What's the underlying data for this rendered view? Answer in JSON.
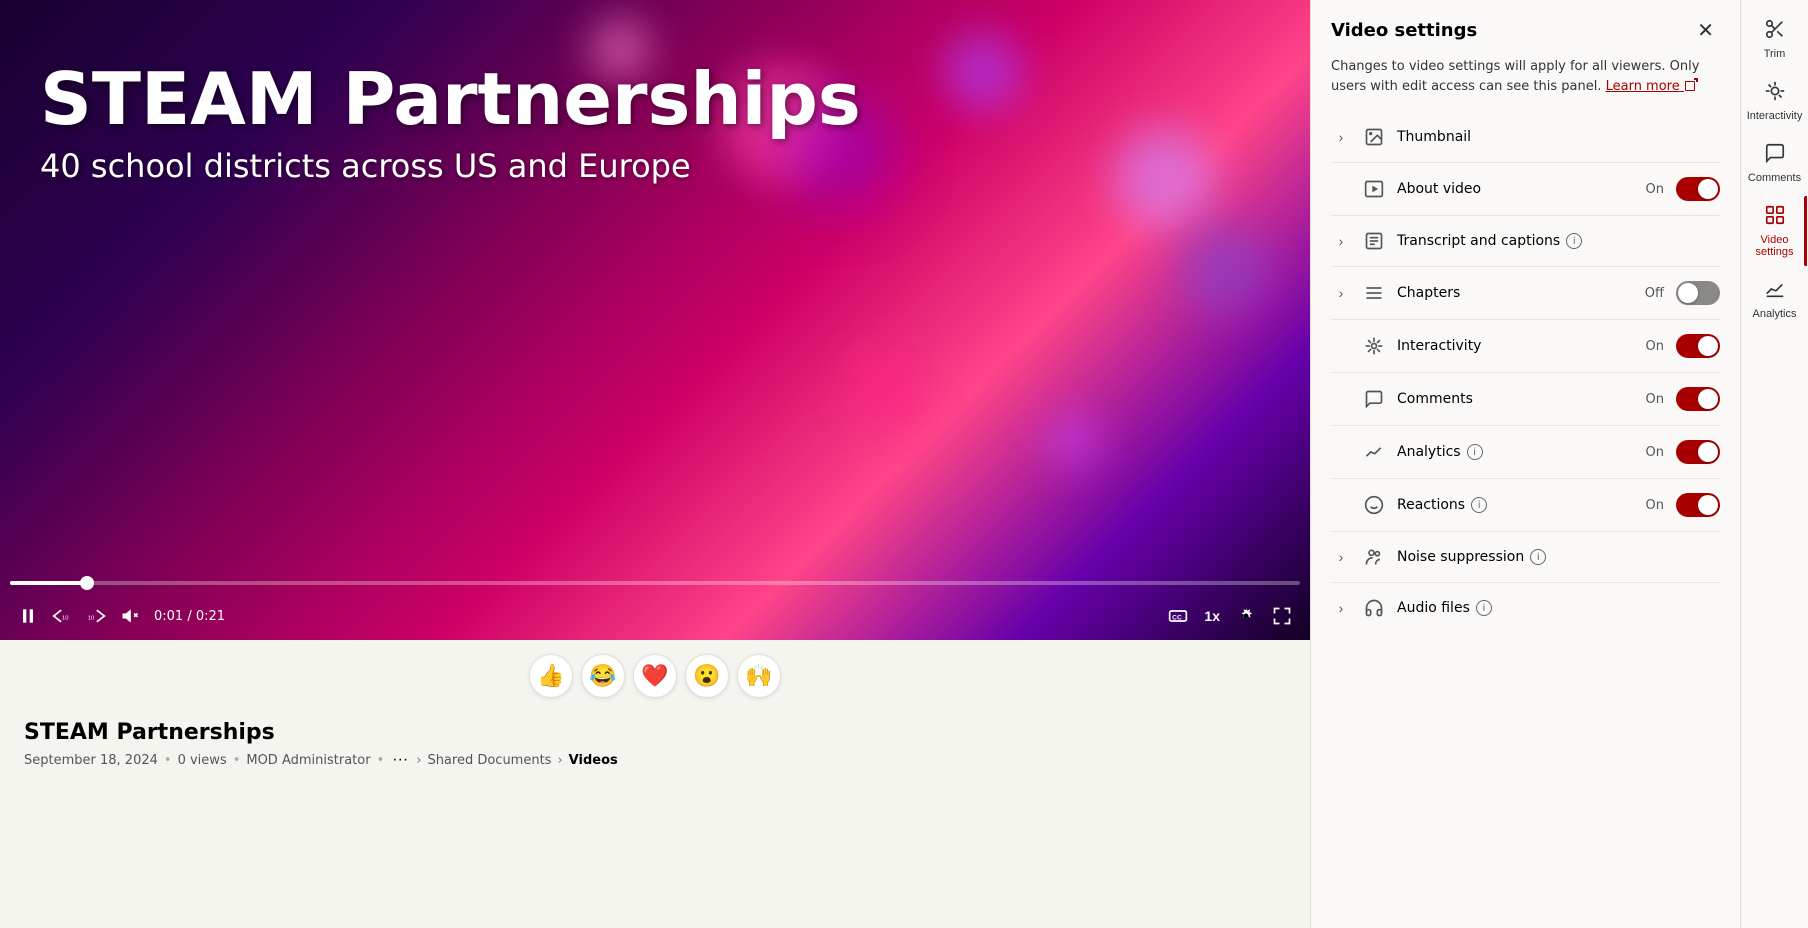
{
  "video": {
    "title": "STEAM Partnerships",
    "subtitle": "40 school districts across US and Europe",
    "date": "September 18, 2024",
    "views": "0 views",
    "author": "MOD Administrator",
    "time_current": "0:01",
    "time_total": "0:21",
    "time_display": "0:01 / 0:21",
    "speed": "1x",
    "breadcrumb": {
      "root": "Shared Documents",
      "current": "Videos"
    }
  },
  "reactions": [
    "👍",
    "😂",
    "❤️",
    "😮",
    "🙌"
  ],
  "settings_panel": {
    "title": "Video settings",
    "notice": "Changes to video settings will apply for all viewers. Only users with edit access can see this panel.",
    "learn_more": "Learn more",
    "rows": [
      {
        "id": "thumbnail",
        "label": "Thumbnail",
        "expandable": true,
        "has_icon": true,
        "icon_type": "image",
        "has_toggle": false,
        "has_info": false
      },
      {
        "id": "about_video",
        "label": "About video",
        "expandable": false,
        "has_icon": true,
        "icon_type": "play",
        "has_toggle": true,
        "toggle_state": "on",
        "status": "On",
        "has_info": false
      },
      {
        "id": "transcript",
        "label": "Transcript and captions",
        "expandable": true,
        "has_icon": true,
        "icon_type": "transcript",
        "has_toggle": false,
        "has_info": true
      },
      {
        "id": "chapters",
        "label": "Chapters",
        "expandable": true,
        "has_icon": true,
        "icon_type": "chapters",
        "has_toggle": true,
        "toggle_state": "off",
        "status": "Off",
        "has_info": false
      },
      {
        "id": "interactivity",
        "label": "Interactivity",
        "expandable": false,
        "has_icon": true,
        "icon_type": "interactivity",
        "has_toggle": true,
        "toggle_state": "on",
        "status": "On",
        "has_info": false
      },
      {
        "id": "comments",
        "label": "Comments",
        "expandable": false,
        "has_icon": true,
        "icon_type": "comments",
        "has_toggle": true,
        "toggle_state": "on",
        "status": "On",
        "has_info": false
      },
      {
        "id": "analytics",
        "label": "Analytics",
        "expandable": false,
        "has_icon": true,
        "icon_type": "analytics",
        "has_toggle": true,
        "toggle_state": "on",
        "status": "On",
        "has_info": true
      },
      {
        "id": "reactions",
        "label": "Reactions",
        "expandable": false,
        "has_icon": true,
        "icon_type": "reactions",
        "has_toggle": true,
        "toggle_state": "on",
        "status": "On",
        "has_info": true
      },
      {
        "id": "noise_suppression",
        "label": "Noise suppression",
        "expandable": true,
        "has_icon": true,
        "icon_type": "noise",
        "has_toggle": false,
        "has_info": true
      },
      {
        "id": "audio_files",
        "label": "Audio files",
        "expandable": true,
        "has_icon": true,
        "icon_type": "audio",
        "has_toggle": false,
        "has_info": true
      }
    ]
  },
  "right_sidebar": {
    "items": [
      {
        "id": "trim",
        "label": "Trim",
        "icon": "trim"
      },
      {
        "id": "interactivity",
        "label": "Interactivity",
        "icon": "interactivity"
      },
      {
        "id": "comments",
        "label": "Comments",
        "icon": "comments"
      },
      {
        "id": "video_settings",
        "label": "Video settings",
        "icon": "settings",
        "active": true
      },
      {
        "id": "analytics",
        "label": "Analytics",
        "icon": "analytics"
      }
    ]
  }
}
